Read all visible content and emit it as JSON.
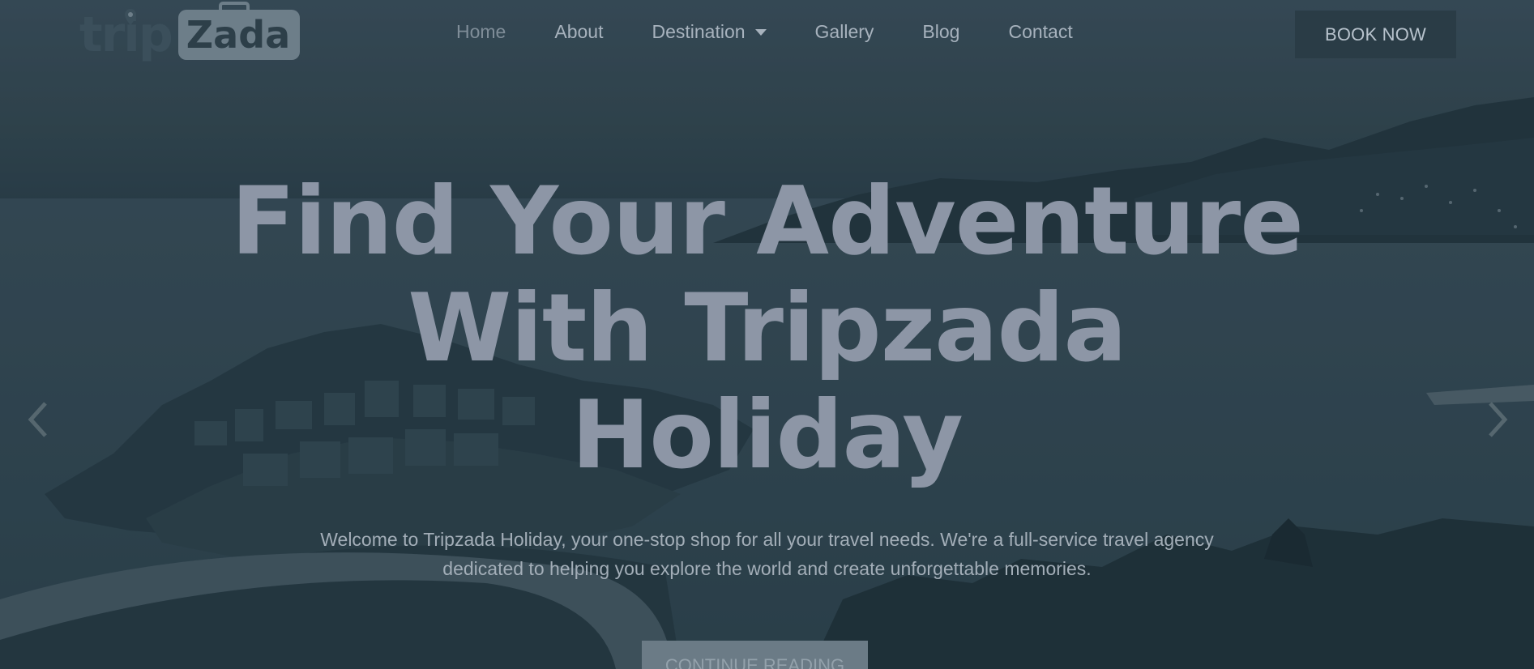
{
  "brand": {
    "logo_part1": "trip",
    "logo_part2": "Zada"
  },
  "nav": {
    "items": [
      {
        "label": "Home"
      },
      {
        "label": "About"
      },
      {
        "label": "Destination"
      },
      {
        "label": "Gallery"
      },
      {
        "label": "Blog"
      },
      {
        "label": "Contact"
      }
    ],
    "active_label": "Home",
    "cta_label": "BOOK NOW"
  },
  "hero": {
    "title_line1": "Find Your Adventure",
    "title_line2": "With Tripzada",
    "title_line3": "Holiday",
    "description_line1": "Welcome to Tripzada Holiday, your one-stop shop for all your travel needs. We're a full-service travel agency",
    "description_line2": "dedicated to helping you explore the world and create unforgettable memories.",
    "button_label": "CONTINUE READING"
  },
  "icons": {
    "prev": "chevron-left-icon",
    "next": "chevron-right-icon",
    "dropdown": "caret-down-icon",
    "pin": "location-pin-icon"
  },
  "colors": {
    "overlay": "#263844",
    "title": "#8d96a6",
    "book_button": "#2a3c46",
    "cta_button": "#6b7b86"
  }
}
